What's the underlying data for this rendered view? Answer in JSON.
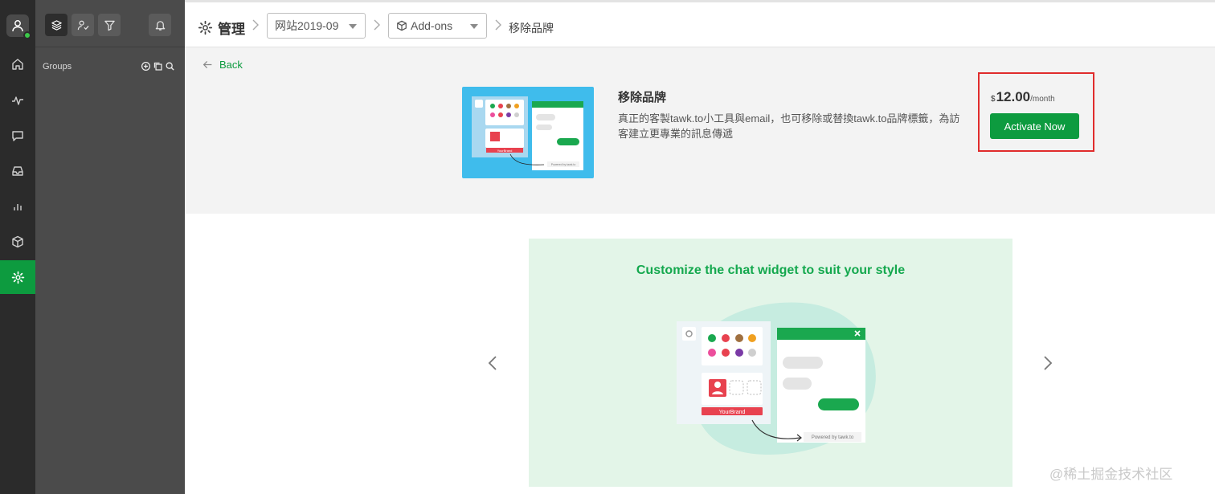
{
  "header": {
    "title": "管理",
    "property_dropdown": "网站2019-09",
    "section_dropdown": "Add-ons",
    "current_page": "移除品牌"
  },
  "panel": {
    "groups_label": "Groups"
  },
  "back_label": "Back",
  "product": {
    "title": "移除品牌",
    "description": "真正的客製tawk.to小工具與email，也可移除或替換tawk.to品牌標籤，為訪客建立更專業的訊息傳遞",
    "thumbnail_brand_label": "YourBrand",
    "thumbnail_powered_label": "Powered by tawk.to"
  },
  "pricing": {
    "currency": "$",
    "amount": "12.00",
    "period": "/month",
    "cta": "Activate Now"
  },
  "carousel": {
    "title": "Customize the chat widget to suit your style",
    "brand_label": "YourBrand",
    "powered_label": "Powered by tawk.to"
  },
  "watermark": "@稀土掘金技术社区",
  "colors": {
    "accent": "#0d9b3f",
    "highlight_border": "#e02c2c",
    "brand_red": "#e8424f",
    "slide_bg": "#e3f5e8"
  },
  "icons": {
    "rail": [
      "user-icon",
      "home-icon",
      "activity-icon",
      "chat-icon",
      "inbox-icon",
      "reports-icon",
      "addons-icon",
      "settings-icon"
    ],
    "panel_tabs": [
      "layers-icon",
      "user-check-icon",
      "filter-icon",
      "bell-icon"
    ],
    "group_actions": [
      "add-circle-icon",
      "copy-icon",
      "search-icon"
    ]
  }
}
